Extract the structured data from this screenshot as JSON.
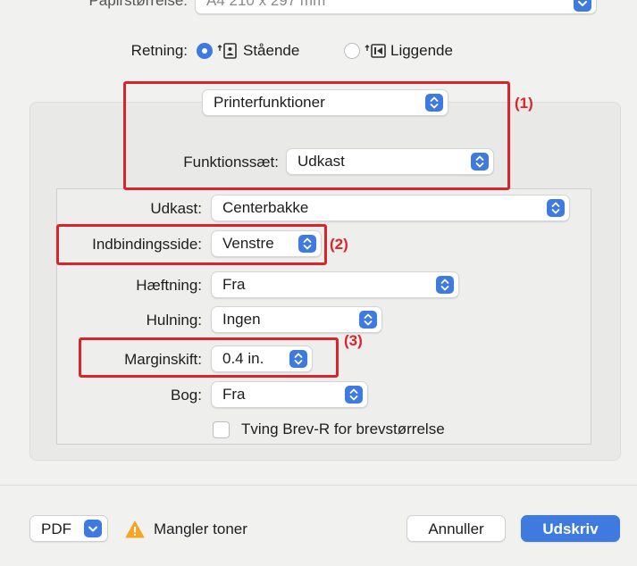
{
  "top": {
    "paper_label": "Papirstørrelse:",
    "paper_value": "A4 210 x 297 mm"
  },
  "orientation": {
    "label": "Retning:",
    "portrait": "Stående",
    "landscape": "Liggende",
    "selected": "portrait"
  },
  "section_popup": {
    "value": "Printerfunktioner"
  },
  "feature_set": {
    "label": "Funktionssæt:",
    "value": "Udkast"
  },
  "settings": {
    "output": {
      "label": "Udkast:",
      "value": "Centerbakke"
    },
    "binding": {
      "label": "Indbindingsside:",
      "value": "Venstre"
    },
    "staple": {
      "label": "Hæftning:",
      "value": "Fra"
    },
    "punch": {
      "label": "Hulning:",
      "value": "Ingen"
    },
    "margin": {
      "label": "Marginskift:",
      "value": "0.4 in."
    },
    "book": {
      "label": "Bog:",
      "value": "Fra"
    },
    "force_letter": {
      "label": "Tving Brev-R for brevstørrelse",
      "checked": false
    }
  },
  "callouts": {
    "c1": "(1)",
    "c2": "(2)",
    "c3": "(3)"
  },
  "footer": {
    "pdf_label": "PDF",
    "warning_text": "Mangler toner",
    "cancel_label": "Annuller",
    "print_label": "Udskriv"
  },
  "colors": {
    "accent": "#3f7ae0",
    "callout_red": "#d9242b",
    "warning": "#f5a623"
  },
  "icons": {
    "chevron": "updown-chevron-icon",
    "portrait": "portrait-page-icon",
    "landscape": "landscape-page-icon",
    "warning": "warning-triangle-icon"
  }
}
